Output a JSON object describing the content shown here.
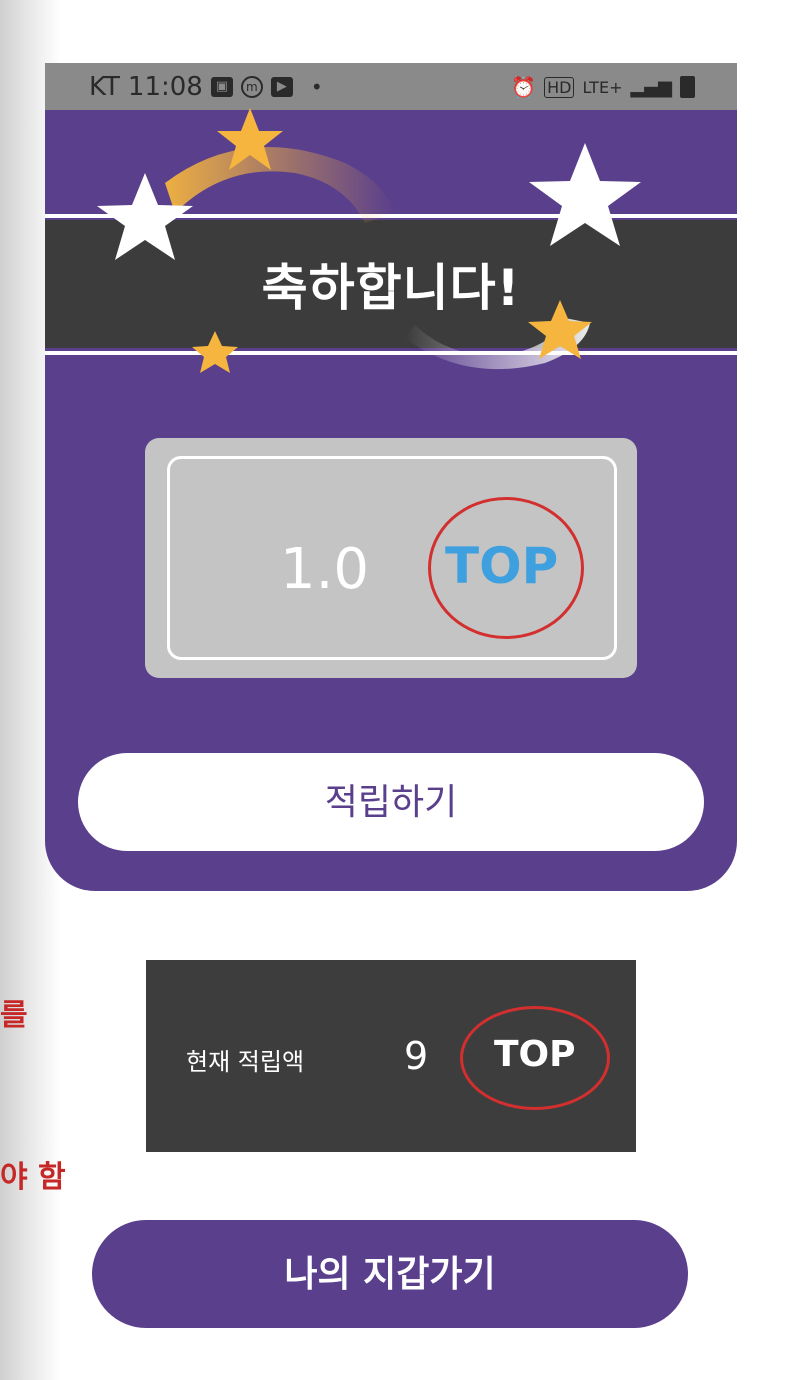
{
  "side_notes": [
    "를",
    "야 함"
  ],
  "status_bar": {
    "carrier": "KT",
    "time": "11:08",
    "network": "LTE+",
    "hd_label": "HD",
    "icon_names": [
      "gallery-icon",
      "m-app-icon",
      "play-icon",
      "alarm-icon",
      "hd-voice-icon",
      "lte-icon",
      "signal-icon",
      "battery-icon"
    ]
  },
  "popup": {
    "title": "축하합니다!",
    "reward_value": "1.0",
    "reward_unit": "TOP",
    "save_button_label": "적립하기"
  },
  "balance": {
    "label": "현재 적립액",
    "value": "9",
    "unit": "TOP"
  },
  "wallet_button_label": "나의 지갑가기",
  "colors": {
    "brand_purple": "#5a3f8c",
    "banner_dark": "#3c3c3c",
    "reward_gray": "#c4c4c4",
    "reward_unit_blue": "#3fa0e0",
    "annotation_red": "#d32f2f",
    "star_gold": "#f5b53f"
  }
}
